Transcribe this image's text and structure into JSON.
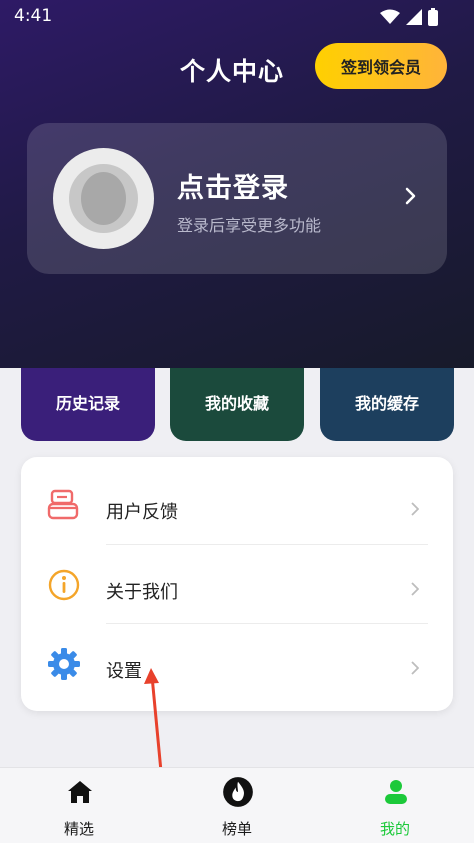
{
  "status_bar": {
    "time": "4:41"
  },
  "header": {
    "title": "个人中心",
    "checkin_button": "签到领会员"
  },
  "login_card": {
    "title": "点击登录",
    "subtitle": "登录后享受更多功能"
  },
  "quick_actions": [
    {
      "label": "历史记录",
      "icon": "history-icon"
    },
    {
      "label": "我的收藏",
      "icon": "favorite-icon"
    },
    {
      "label": "我的缓存",
      "icon": "cache-icon"
    }
  ],
  "menu": [
    {
      "label": "用户反馈",
      "icon": "feedback-icon",
      "color": "#f06a6a"
    },
    {
      "label": "关于我们",
      "icon": "info-icon",
      "color": "#f4a52a"
    },
    {
      "label": "设置",
      "icon": "gear-icon",
      "color": "#3a8be8"
    }
  ],
  "tab_bar": [
    {
      "label": "精选",
      "icon": "home-icon",
      "active": false
    },
    {
      "label": "榜单",
      "icon": "flame-icon",
      "active": false
    },
    {
      "label": "我的",
      "icon": "user-icon",
      "active": true
    }
  ],
  "colors": {
    "accent": "#1cc93a",
    "checkin": "#ffc20e",
    "annotation_arrow": "#e8412c"
  }
}
